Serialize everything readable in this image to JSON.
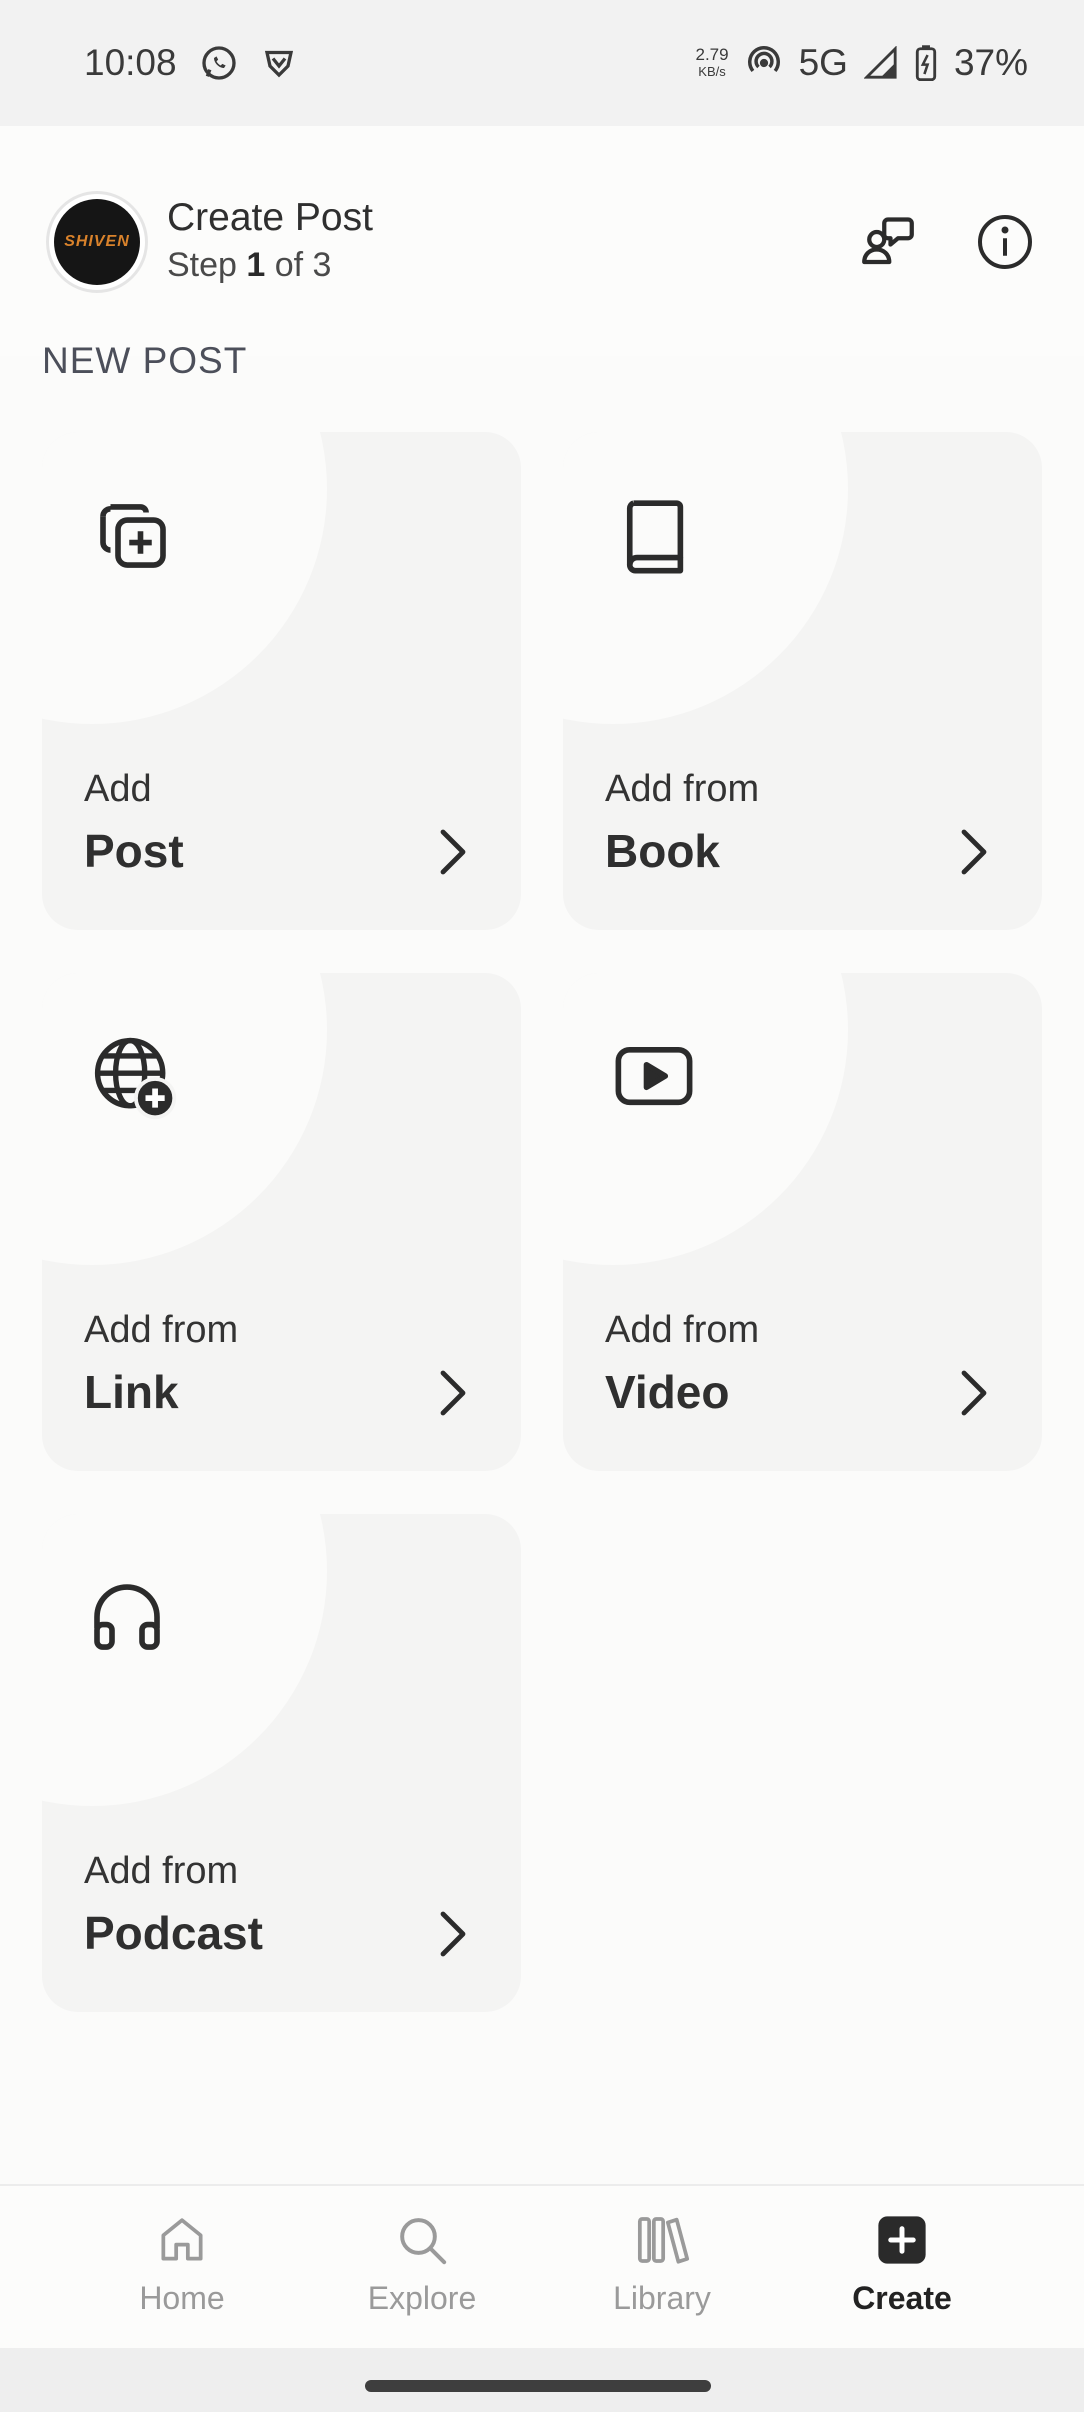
{
  "status_bar": {
    "time": "10:08",
    "net_speed_value": "2.79",
    "net_speed_unit": "KB/s",
    "network": "5G",
    "battery": "37%",
    "icons": [
      "whatsapp-icon",
      "vpn-shield-icon",
      "hotspot-icon",
      "signal-icon",
      "battery-charging-icon"
    ]
  },
  "header": {
    "avatar_text": "SHIVEN",
    "title": "Create Post",
    "step_prefix": "Step ",
    "step_current": "1",
    "step_suffix": " of 3",
    "icons": [
      "chat-icon",
      "info-icon"
    ]
  },
  "section_label": "NEW POST",
  "cards": [
    {
      "line1": "Add",
      "line2": "Post",
      "icon": "add-post-icon"
    },
    {
      "line1": "Add from",
      "line2": "Book",
      "icon": "book-icon"
    },
    {
      "line1": "Add from",
      "line2": "Link",
      "icon": "globe-plus-icon"
    },
    {
      "line1": "Add from",
      "line2": "Video",
      "icon": "play-icon"
    },
    {
      "line1": "Add from",
      "line2": "Podcast",
      "icon": "headphones-icon"
    }
  ],
  "bottom_nav": [
    {
      "label": "Home",
      "icon": "home-icon",
      "active": false
    },
    {
      "label": "Explore",
      "icon": "search-icon",
      "active": false
    },
    {
      "label": "Library",
      "icon": "library-icon",
      "active": false
    },
    {
      "label": "Create",
      "icon": "create-icon",
      "active": true
    }
  ],
  "colors": {
    "background": "#fbfbfa",
    "card": "#f4f4f3",
    "active_nav": "#222222",
    "inactive_nav": "#9a9a9a"
  }
}
